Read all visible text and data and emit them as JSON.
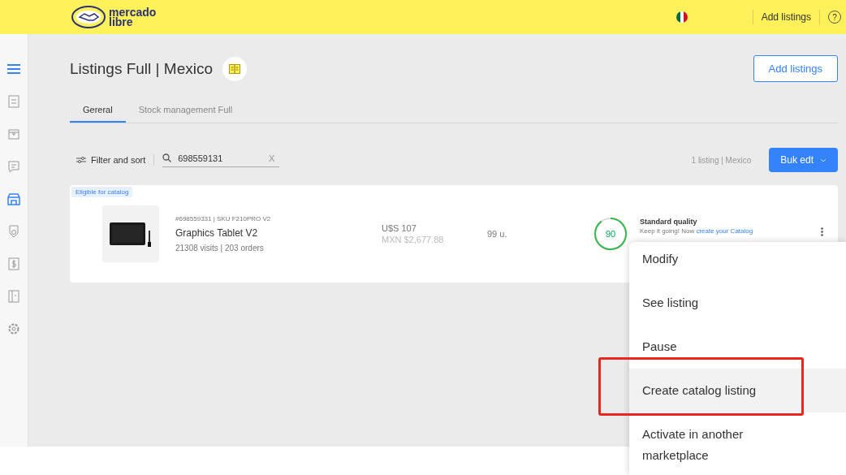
{
  "header": {
    "logo_text": [
      "mercado",
      "libre"
    ],
    "add_listings": "Add listings",
    "help": "?"
  },
  "sidebar": {
    "items": [
      {
        "kind": "menu"
      },
      {
        "kind": "list",
        "selected": false
      },
      {
        "kind": "box",
        "selected": false
      },
      {
        "kind": "chat",
        "selected": false
      },
      {
        "kind": "store",
        "selected": true
      },
      {
        "kind": "badge",
        "selected": false
      },
      {
        "kind": "dollar",
        "selected": false
      },
      {
        "kind": "book",
        "selected": false
      },
      {
        "kind": "gear",
        "selected": false
      }
    ]
  },
  "page": {
    "title": "Listings Full | Mexico",
    "add_listings_button": "Add listings"
  },
  "tabs": [
    {
      "label": "Gereral",
      "selected": true
    },
    {
      "label": "Stock management Full",
      "selected": false
    }
  ],
  "toolbar": {
    "filter": "Filter and sort",
    "search_value": "698559131",
    "clear": "X",
    "count": "1 listing | Mexico",
    "bulk_edit": "Buk edt"
  },
  "listing": {
    "tag": "Eligible for catalog",
    "id": "#698559331 | SKU F210PRO V2",
    "title": "Graphics Tablet V2",
    "stats": "21308 visits | 203 orders",
    "price_usd": "U$S 107",
    "price_mxn": "MXN $2,677.88",
    "stock": "99 u.",
    "quality_score": "90",
    "level": 0.9,
    "quality_title": "Standard quality",
    "quality_text": "Keep it going! Now ",
    "quality_link": "create your Catalog"
  },
  "menu": {
    "items": [
      {
        "label": "Modify",
        "selected": false
      },
      {
        "label": "See listing",
        "selected": false
      },
      {
        "label": "Pause",
        "selected": false
      },
      {
        "label": "Create catalog listing",
        "selected": true
      },
      {
        "label": "Activate in another marketplace",
        "selected": false
      }
    ]
  }
}
